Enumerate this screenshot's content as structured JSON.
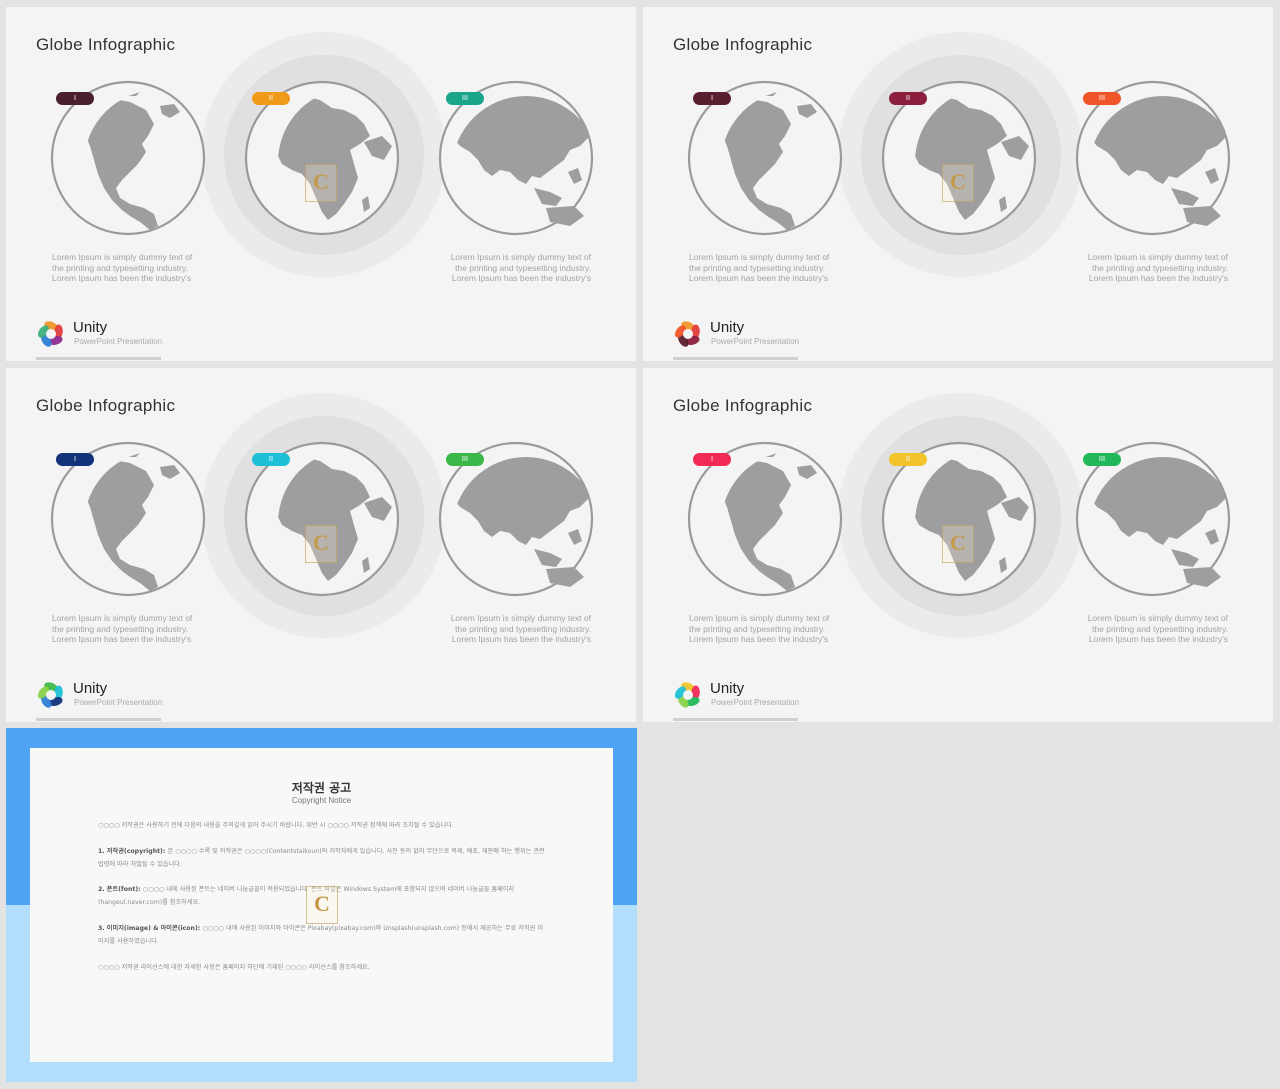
{
  "slides": [
    {
      "title": "Globe Infographic",
      "pills": [
        {
          "label": "I",
          "color": "#4a1f2e"
        },
        {
          "label": "II",
          "color": "#f09a1a"
        },
        {
          "label": "III",
          "color": "#1aa58a"
        }
      ],
      "desc_left": [
        "Lorem Ipsum is simply dummy text of",
        "the printing and typesetting industry.",
        "Lorem Ipsum has been the industry's"
      ],
      "desc_right": [
        "Lorem Ipsum is simply dummy text of",
        "the printing and typesetting industry.",
        "Lorem Ipsum has been the industry's"
      ],
      "logo_colors": [
        "#f0962a",
        "#e23c3c",
        "#8f2a8f",
        "#2e7fd6",
        "#3fb07c"
      ],
      "brand": "Unity",
      "brand_sub": "PowerPoint Presentation"
    },
    {
      "title": "Globe Infographic",
      "pills": [
        {
          "label": "I",
          "color": "#5a1f2e"
        },
        {
          "label": "II",
          "color": "#8c1f3e"
        },
        {
          "label": "III",
          "color": "#f0552a"
        }
      ],
      "desc_left": [
        "Lorem Ipsum is simply dummy text of",
        "the printing and typesetting industry.",
        "Lorem Ipsum has been the industry's"
      ],
      "desc_right": [
        "Lorem Ipsum is simply dummy text of",
        "the printing and typesetting industry.",
        "Lorem Ipsum has been the industry's"
      ],
      "logo_colors": [
        "#f0962a",
        "#e23c3c",
        "#8c1f3e",
        "#5a1f2e",
        "#f0552a"
      ],
      "brand": "Unity",
      "brand_sub": "PowerPoint Presentation"
    },
    {
      "title": "Globe Infographic",
      "pills": [
        {
          "label": "I",
          "color": "#12337a"
        },
        {
          "label": "II",
          "color": "#1ec0d8"
        },
        {
          "label": "III",
          "color": "#3cb84a"
        }
      ],
      "desc_left": [
        "Lorem Ipsum is simply dummy text of",
        "the printing and typesetting industry.",
        "Lorem Ipsum has been the industry's"
      ],
      "desc_right": [
        "Lorem Ipsum is simply dummy text of",
        "the printing and typesetting industry.",
        "Lorem Ipsum has been the industry's"
      ],
      "logo_colors": [
        "#3cb84a",
        "#1ec0d8",
        "#12337a",
        "#2e7fd6",
        "#8ad14a"
      ],
      "brand": "Unity",
      "brand_sub": "PowerPoint Presentation"
    },
    {
      "title": "Globe Infographic",
      "pills": [
        {
          "label": "I",
          "color": "#f02a55"
        },
        {
          "label": "II",
          "color": "#f0c42a"
        },
        {
          "label": "III",
          "color": "#22b85a"
        }
      ],
      "desc_left": [
        "Lorem Ipsum is simply dummy text of",
        "the printing and typesetting industry.",
        "Lorem Ipsum has been the industry's"
      ],
      "desc_right": [
        "Lorem Ipsum is simply dummy text of",
        "the printing and typesetting industry.",
        "Lorem Ipsum has been the industry's"
      ],
      "logo_colors": [
        "#f0c42a",
        "#f02a55",
        "#22b85a",
        "#8ad14a",
        "#1ec0d8"
      ],
      "brand": "Unity",
      "brand_sub": "PowerPoint Presentation"
    }
  ],
  "copyright": {
    "title": "저작권 공고",
    "subtitle": "Copyright Notice",
    "paragraphs": [
      {
        "heading": "",
        "text": "○○○○ 저작권은 사용하기 전에 다음의 내용을 주의깊게 읽어 주시기 바랍니다. 위반 시 ○○○○ 저작권 정책에 따라 조치될 수 있습니다."
      },
      {
        "heading": "1. 저작권(copyright): ",
        "text": "본 ○○○○ 수록 및 저작권은 ○○○○(Contentstaikoun)의 저작자에게 있습니다. 사전 동의 없이 무단으로 복제, 배포, 재판매 하는 행위는 관련 법령에 따라 처벌될 수 있습니다."
      },
      {
        "heading": "2. 폰트(font): ",
        "text": "○○○○ 내에 사용된 폰트는 네이버 나눔글꼴이 적용되었습니다. 폰트 파일은 Windows System에 포함되지 않으며 네이버 나눔글꼴 홈페이지(hangeul.naver.com)를 참조하세요."
      },
      {
        "heading": "3. 이미지(image) & 아이콘(icon): ",
        "text": "○○○○ 내에 사용된 이미지와 아이콘은 Pixabay(pixabay.com)와 Unsplash(unsplash.com) 등에서 제공하는 무료 저작권 이미지를 사용하였습니다."
      },
      {
        "heading": "",
        "text": "○○○○ 저작권 라이선스에 대한 자세한 사항은 홈페이지 하단에 기재된 ○○○○ 라이선스를 참조하세요."
      }
    ]
  }
}
